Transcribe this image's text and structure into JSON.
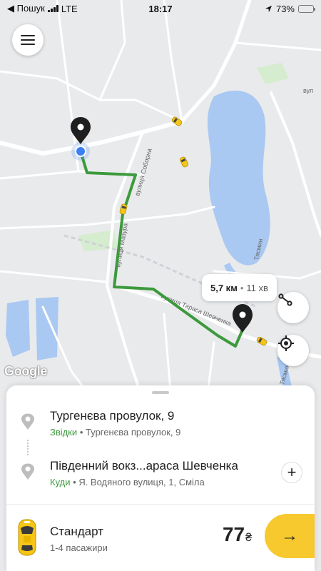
{
  "status_bar": {
    "back_app": "◀ Пошук",
    "network": "LTE",
    "time": "18:17",
    "battery": "73%",
    "battery_level": 0.73
  },
  "map": {
    "street_labels": [
      "вулиця Соборна",
      "вулиця Мазура",
      "вулиця Тараса Шевченка",
      "Тясмин",
      "вул",
      "Тясмин"
    ],
    "route_info": {
      "distance": "5,7 км",
      "separator": "•",
      "duration": "11 хв"
    },
    "attribution": "Google",
    "colors": {
      "route": "#3c9a3c",
      "water": "#a9c8f2",
      "land": "#e9eaec",
      "park": "#cfe8c9",
      "taxi": "#f5c518"
    },
    "icons": {
      "menu": "menu-icon",
      "route_overview": "route-icon",
      "my_location": "location-target-icon"
    }
  },
  "sheet": {
    "from": {
      "title": "Тургенєва провулок, 9",
      "kind": "Звідки",
      "separator": "•",
      "detail": "Тургенєва провулок, 9"
    },
    "to": {
      "title": "Південний вокз...араса Шевченка",
      "kind": "Куди",
      "separator": "•",
      "detail": "Я. Водяного вулиця, 1, Сміла"
    },
    "add_stop_label": "+",
    "tariff": {
      "name": "Стандарт",
      "seats": "1-4 пасажири",
      "price": "77",
      "currency": "₴"
    },
    "go_label": "→"
  }
}
